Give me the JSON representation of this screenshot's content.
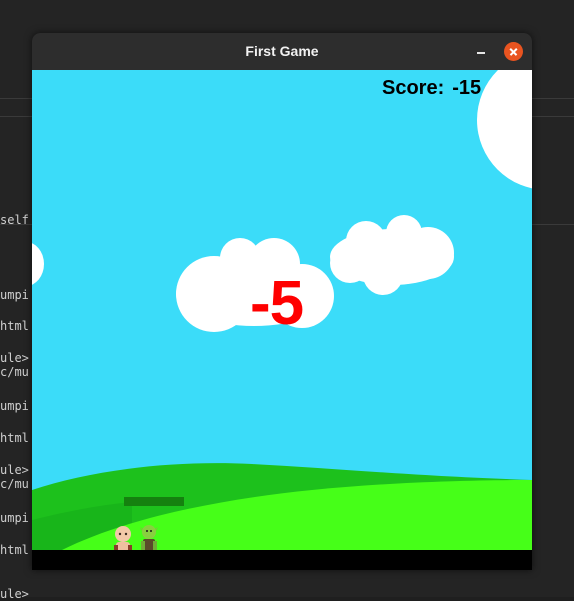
{
  "window": {
    "title": "First Game"
  },
  "hud": {
    "score_label": "Score:",
    "score_value": "-15"
  },
  "popup": {
    "damage_text": "-5"
  },
  "player": {
    "health_fraction": 1.0
  },
  "background_code_fragments": [
    "self",
    "umpi",
    "html",
    "ule>",
    "c/mu",
    "umpi",
    "html",
    "ule>",
    "c/mu",
    "umpi",
    "html",
    "ule>"
  ],
  "colors": {
    "sky": "#3bdcf9",
    "ground_light": "#46ff18",
    "ground_dark": "#1dc11c",
    "damage_text": "#ff0000",
    "health_bar": "#15810f",
    "close_button": "#e95420"
  },
  "icons": {
    "minimize": "minimize-icon",
    "close": "close-icon"
  }
}
